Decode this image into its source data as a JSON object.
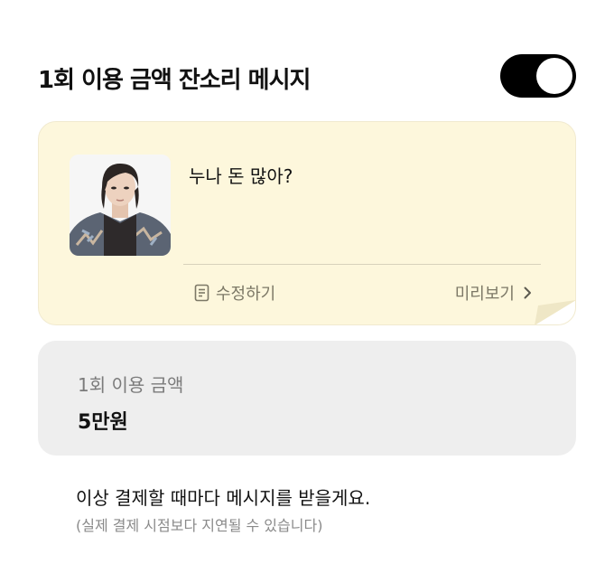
{
  "header": {
    "title": "1회 이용 금액 잔소리 메시지",
    "toggle_on": true
  },
  "message_card": {
    "message": "누나 돈 많아?",
    "edit_label": "수정하기",
    "preview_label": "미리보기",
    "edit_icon": "document-edit-icon",
    "preview_icon": "chevron-right-icon",
    "background_color": "#fdf7dc"
  },
  "amount_card": {
    "label": "1회 이용 금액",
    "value": "5만원",
    "background_color": "#eeeeee"
  },
  "note": {
    "main": "이상 결제할 때마다 메시지를 받을게요.",
    "sub": "(실제 결제 시점보다 지연될 수 있습니다)"
  }
}
